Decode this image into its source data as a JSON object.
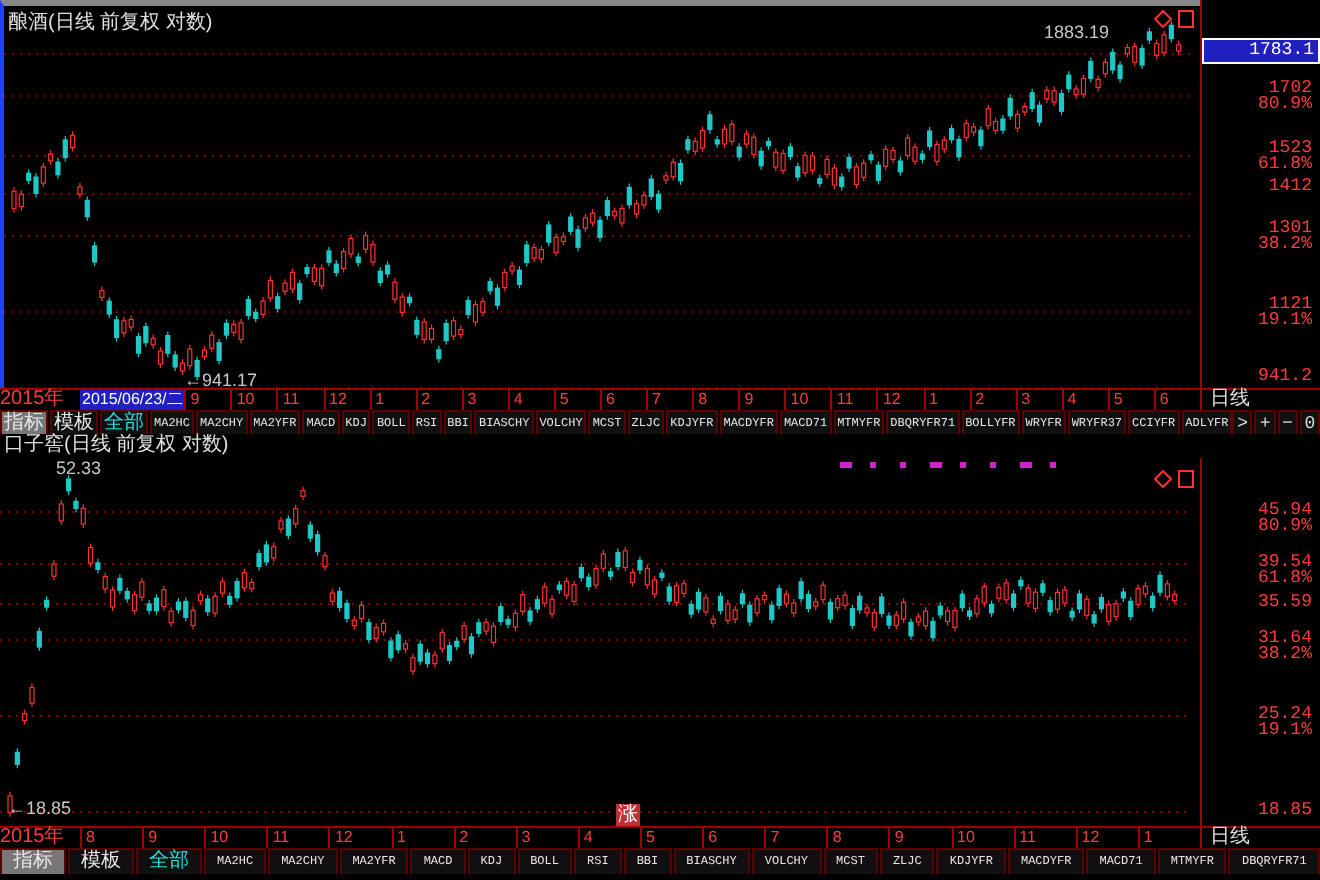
{
  "panels": [
    {
      "title": "酿酒(日线 前复权 对数)",
      "high_label": "1883.19",
      "low_label": "←941.17",
      "axis_labels": [
        {
          "value": "1783.1",
          "current": true
        },
        {
          "value": "1702",
          "pct": "80.9%",
          "current": false
        },
        {
          "value": "1523",
          "pct": "61.8%",
          "current": false
        },
        {
          "value": "1412",
          "current": false
        },
        {
          "value": "1301",
          "pct": "38.2%",
          "current": false
        },
        {
          "value": "1121",
          "pct": "19.1%",
          "current": false
        },
        {
          "value": "941.2",
          "current": false
        }
      ],
      "date_axis": {
        "year": "2015年",
        "cursor": "2015/06/23/二",
        "months": [
          "9",
          "10",
          "11",
          "12",
          "1",
          "2",
          "3",
          "4",
          "5",
          "6",
          "7",
          "8",
          "9",
          "10",
          "11",
          "12",
          "1",
          "2",
          "3",
          "4",
          "5",
          "6"
        ],
        "period": "日线"
      },
      "tabs": [
        {
          "label": "指标",
          "selected": true,
          "highlight": false
        },
        {
          "label": "模板",
          "selected": false,
          "highlight": false
        },
        {
          "label": "全部",
          "selected": false,
          "highlight": true
        },
        {
          "label": "MA2HC",
          "selected": false,
          "highlight": false
        },
        {
          "label": "MA2CHY",
          "selected": false,
          "highlight": false
        },
        {
          "label": "MA2YFR",
          "selected": false,
          "highlight": false
        },
        {
          "label": "MACD",
          "selected": false,
          "highlight": false
        },
        {
          "label": "KDJ",
          "selected": false,
          "highlight": false
        },
        {
          "label": "BOLL",
          "selected": false,
          "highlight": false
        },
        {
          "label": "RSI",
          "selected": false,
          "highlight": false
        },
        {
          "label": "BBI",
          "selected": false,
          "highlight": false
        },
        {
          "label": "BIASCHY",
          "selected": false,
          "highlight": false
        },
        {
          "label": "VOLCHY",
          "selected": false,
          "highlight": false
        },
        {
          "label": "MCST",
          "selected": false,
          "highlight": false
        },
        {
          "label": "ZLJC",
          "selected": false,
          "highlight": false
        },
        {
          "label": "KDJYFR",
          "selected": false,
          "highlight": false
        },
        {
          "label": "MACDYFR",
          "selected": false,
          "highlight": false
        },
        {
          "label": "MACD71",
          "selected": false,
          "highlight": false
        },
        {
          "label": "MTMYFR",
          "selected": false,
          "highlight": false
        },
        {
          "label": "DBQRYFR71",
          "selected": false,
          "highlight": false
        },
        {
          "label": "BOLLYFR",
          "selected": false,
          "highlight": false
        },
        {
          "label": "WRYFR",
          "selected": false,
          "highlight": false
        },
        {
          "label": "WRYFR37",
          "selected": false,
          "highlight": false
        },
        {
          "label": "CCIYFR",
          "selected": false,
          "highlight": false
        },
        {
          "label": "ADLYFR",
          "selected": false,
          "highlight": false
        }
      ],
      "side_buttons": [
        ">",
        "+",
        "−",
        "0"
      ]
    },
    {
      "title": "口子窖(日线 前复权 对数)",
      "high_label": "52.33",
      "low_label": "←18.85",
      "tag": "涨",
      "axis_labels": [
        {
          "value": "45.94",
          "pct": "80.9%",
          "current": false
        },
        {
          "value": "39.54",
          "pct": "61.8%",
          "current": false
        },
        {
          "value": "35.59",
          "current": false
        },
        {
          "value": "31.64",
          "pct": "38.2%",
          "current": false
        },
        {
          "value": "25.24",
          "pct": "19.1%",
          "current": false
        },
        {
          "value": "18.85",
          "current": false
        }
      ],
      "date_axis": {
        "year": "2015年",
        "months": [
          "8",
          "9",
          "10",
          "11",
          "12",
          "1",
          "2",
          "3",
          "4",
          "5",
          "6",
          "7",
          "8",
          "9",
          "10",
          "11",
          "12",
          "1"
        ],
        "period": "日线"
      },
      "tabs": [
        {
          "label": "指标",
          "selected": true,
          "highlight": false
        },
        {
          "label": "模板",
          "selected": false,
          "highlight": false
        },
        {
          "label": "全部",
          "selected": false,
          "highlight": true
        },
        {
          "label": "MA2HC",
          "selected": false,
          "highlight": false
        },
        {
          "label": "MA2CHY",
          "selected": false,
          "highlight": false
        },
        {
          "label": "MA2YFR",
          "selected": false,
          "highlight": false
        },
        {
          "label": "MACD",
          "selected": false,
          "highlight": false
        },
        {
          "label": "KDJ",
          "selected": false,
          "highlight": false
        },
        {
          "label": "BOLL",
          "selected": false,
          "highlight": false
        },
        {
          "label": "RSI",
          "selected": false,
          "highlight": false
        },
        {
          "label": "BBI",
          "selected": false,
          "highlight": false
        },
        {
          "label": "BIASCHY",
          "selected": false,
          "highlight": false
        },
        {
          "label": "VOLCHY",
          "selected": false,
          "highlight": false
        },
        {
          "label": "MCST",
          "selected": false,
          "highlight": false
        },
        {
          "label": "ZLJC",
          "selected": false,
          "highlight": false
        },
        {
          "label": "KDJYFR",
          "selected": false,
          "highlight": false
        },
        {
          "label": "MACDYFR",
          "selected": false,
          "highlight": false
        },
        {
          "label": "MACD71",
          "selected": false,
          "highlight": false
        },
        {
          "label": "MTMYFR",
          "selected": false,
          "highlight": false
        },
        {
          "label": "DBQRYFR71",
          "selected": false,
          "highlight": false
        }
      ]
    }
  ]
}
